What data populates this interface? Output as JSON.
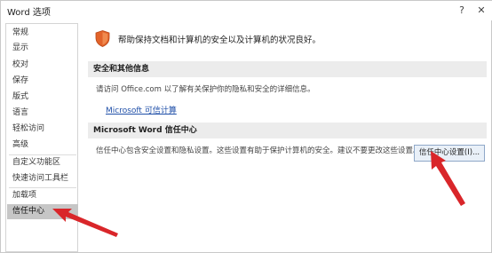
{
  "window": {
    "title": "Word 选项",
    "help_glyph": "?",
    "close_glyph": "✕"
  },
  "sidebar": {
    "items": [
      {
        "label": "常规"
      },
      {
        "label": "显示"
      },
      {
        "label": "校对"
      },
      {
        "label": "保存"
      },
      {
        "label": "版式"
      },
      {
        "label": "语言"
      },
      {
        "label": "轻松访问"
      },
      {
        "label": "高级"
      },
      {
        "label": "自定义功能区"
      },
      {
        "label": "快速访问工具栏"
      },
      {
        "label": "加载项"
      },
      {
        "label": "信任中心"
      }
    ],
    "active": "信任中心"
  },
  "main": {
    "intro_text": "帮助保持文档和计算机的安全以及计算机的状况良好。",
    "privacy_section": {
      "heading": "安全和其他信息",
      "text": "请访问 Office.com 以了解有关保护你的隐私和安全的详细信息。",
      "link": "Microsoft 可信计算"
    },
    "trust_section": {
      "heading": "Microsoft Word 信任中心",
      "text": "信任中心包含安全设置和隐私设置。这些设置有助于保护计算机的安全。建议不要更改这些设置。",
      "button": "信任中心设置(I)..."
    }
  },
  "icons": {
    "shield": "shield-icon",
    "help": "help-icon",
    "close": "close-icon"
  },
  "colors": {
    "annotation_arrow": "#d9262a",
    "shield": "#e2632a",
    "link": "#1f4fa8",
    "active_nav": "#c6c6c6"
  }
}
